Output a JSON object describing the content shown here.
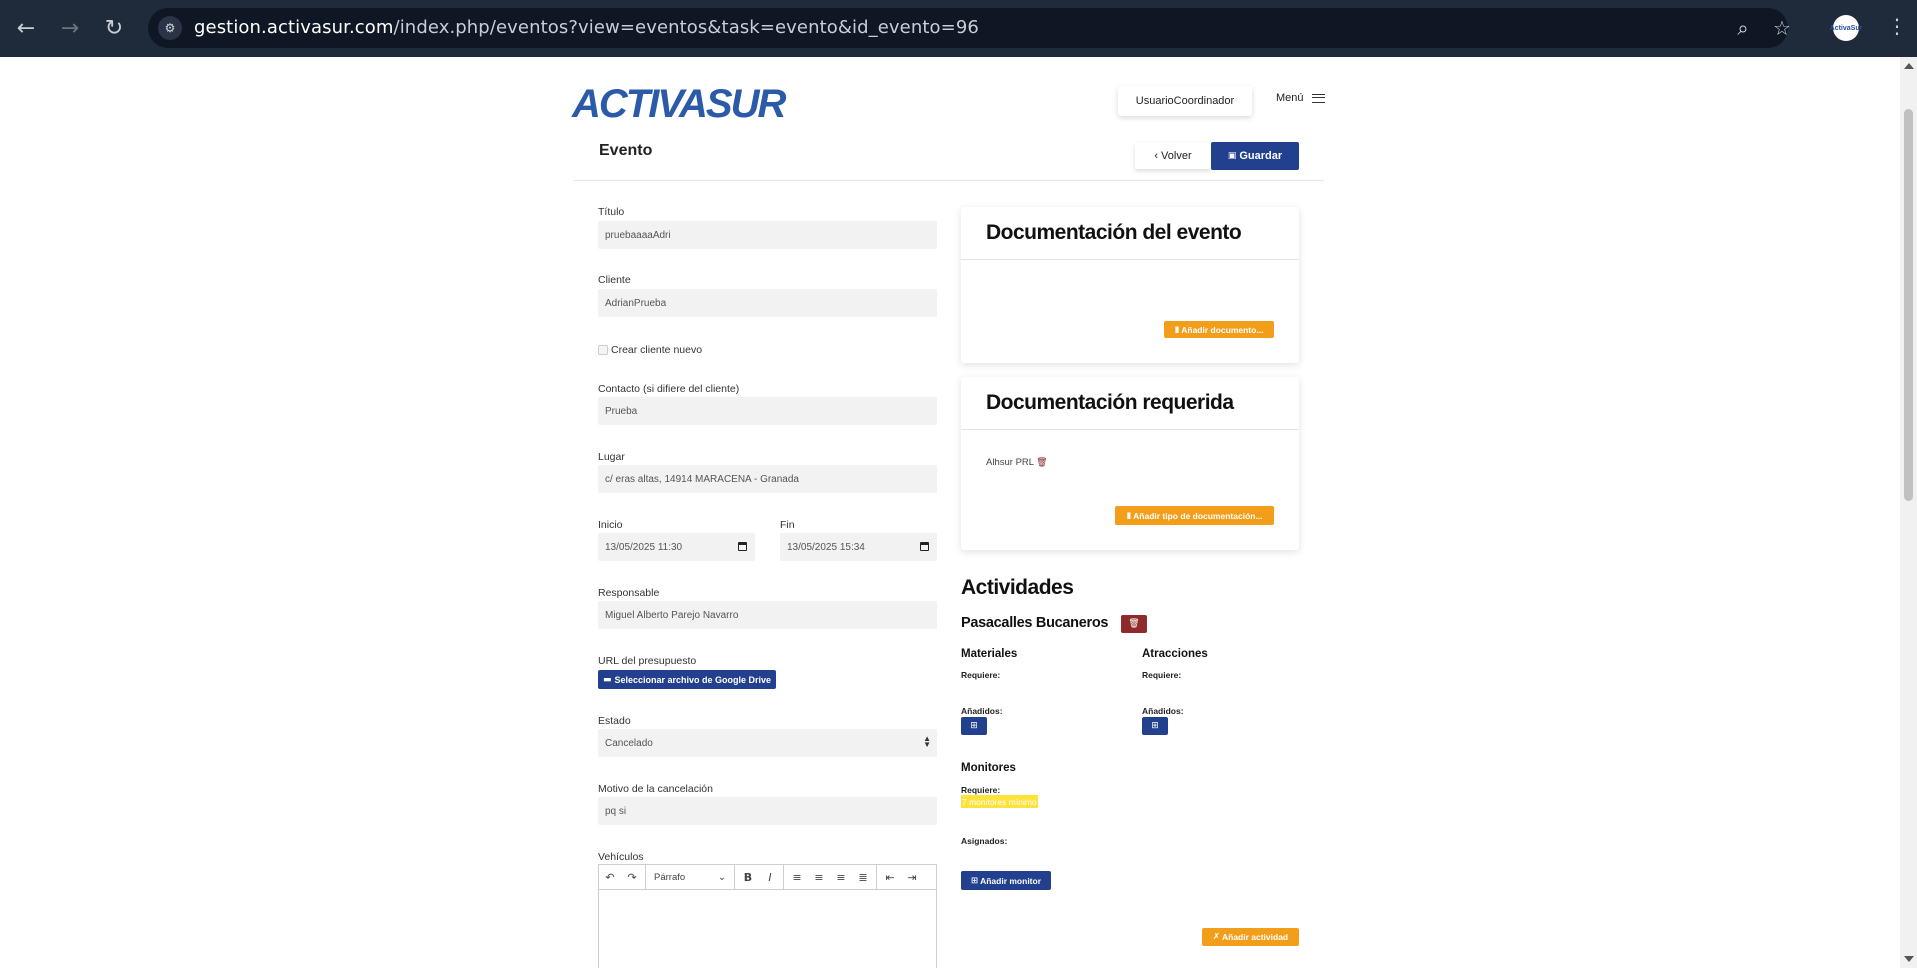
{
  "browser": {
    "url_host": "gestion.activasur.com",
    "url_path": "/index.php/eventos?view=eventos&task=evento&id_evento=96",
    "profile_label": "ActivaSur"
  },
  "header": {
    "logo_text": "ACTIVASUR",
    "user": "UsuarioCoordinador",
    "menu_label": "Menú"
  },
  "card": {
    "title": "Evento",
    "back_label": "Volver",
    "save_label": "Guardar"
  },
  "form": {
    "titulo_label": "Título",
    "titulo_value": "pruebaaaaAdri",
    "cliente_label": "Cliente",
    "cliente_value": "AdrianPrueba",
    "crear_cliente_label": "Crear cliente nuevo",
    "contacto_label": "Contacto (si difiere del cliente)",
    "contacto_value": "Prueba",
    "lugar_label": "Lugar",
    "lugar_value": "c/ eras altas, 14914 MARACENA - Granada",
    "inicio_label": "Inicio",
    "inicio_value": "13/05/2025 11:30",
    "fin_label": "Fin",
    "fin_value": "13/05/2025 15:34",
    "responsable_label": "Responsable",
    "responsable_value": "Miguel Alberto Parejo Navarro",
    "url_label": "URL del presupuesto",
    "drive_button": "Seleccionar archivo de Google Drive",
    "estado_label": "Estado",
    "estado_value": "Cancelado",
    "motivo_label": "Motivo de la cancelación",
    "motivo_value": "pq si",
    "vehiculos_label": "Vehículos",
    "editor_format": "Párrafo"
  },
  "documentacion_evento": {
    "title": "Documentación del evento",
    "add_button": "Añadir documento..."
  },
  "documentacion_requerida": {
    "title": "Documentación requerida",
    "items": [
      "Alhsur PRL"
    ],
    "add_button": "Añadir tipo de documentación..."
  },
  "actividades": {
    "title": "Actividades",
    "activity_name": "Pasacalles Bucaneros",
    "materiales": {
      "title": "Materiales",
      "requiere": "Requiere:",
      "anadidos": "Añadidos:"
    },
    "atracciones": {
      "title": "Atracciones",
      "requiere": "Requiere:",
      "anadidos": "Añadidos:"
    },
    "monitores": {
      "title": "Monitores",
      "requiere": "Requiere:",
      "requiere_value": "7 monitores mínimo",
      "asignados": "Asignados:",
      "add_button": "Añadir monitor"
    },
    "add_activity_button": "Añadir actividad"
  },
  "colors": {
    "primary": "#23408e",
    "accent": "#f29e1b",
    "danger": "#8e2a2a",
    "highlight": "#ffe23a"
  }
}
